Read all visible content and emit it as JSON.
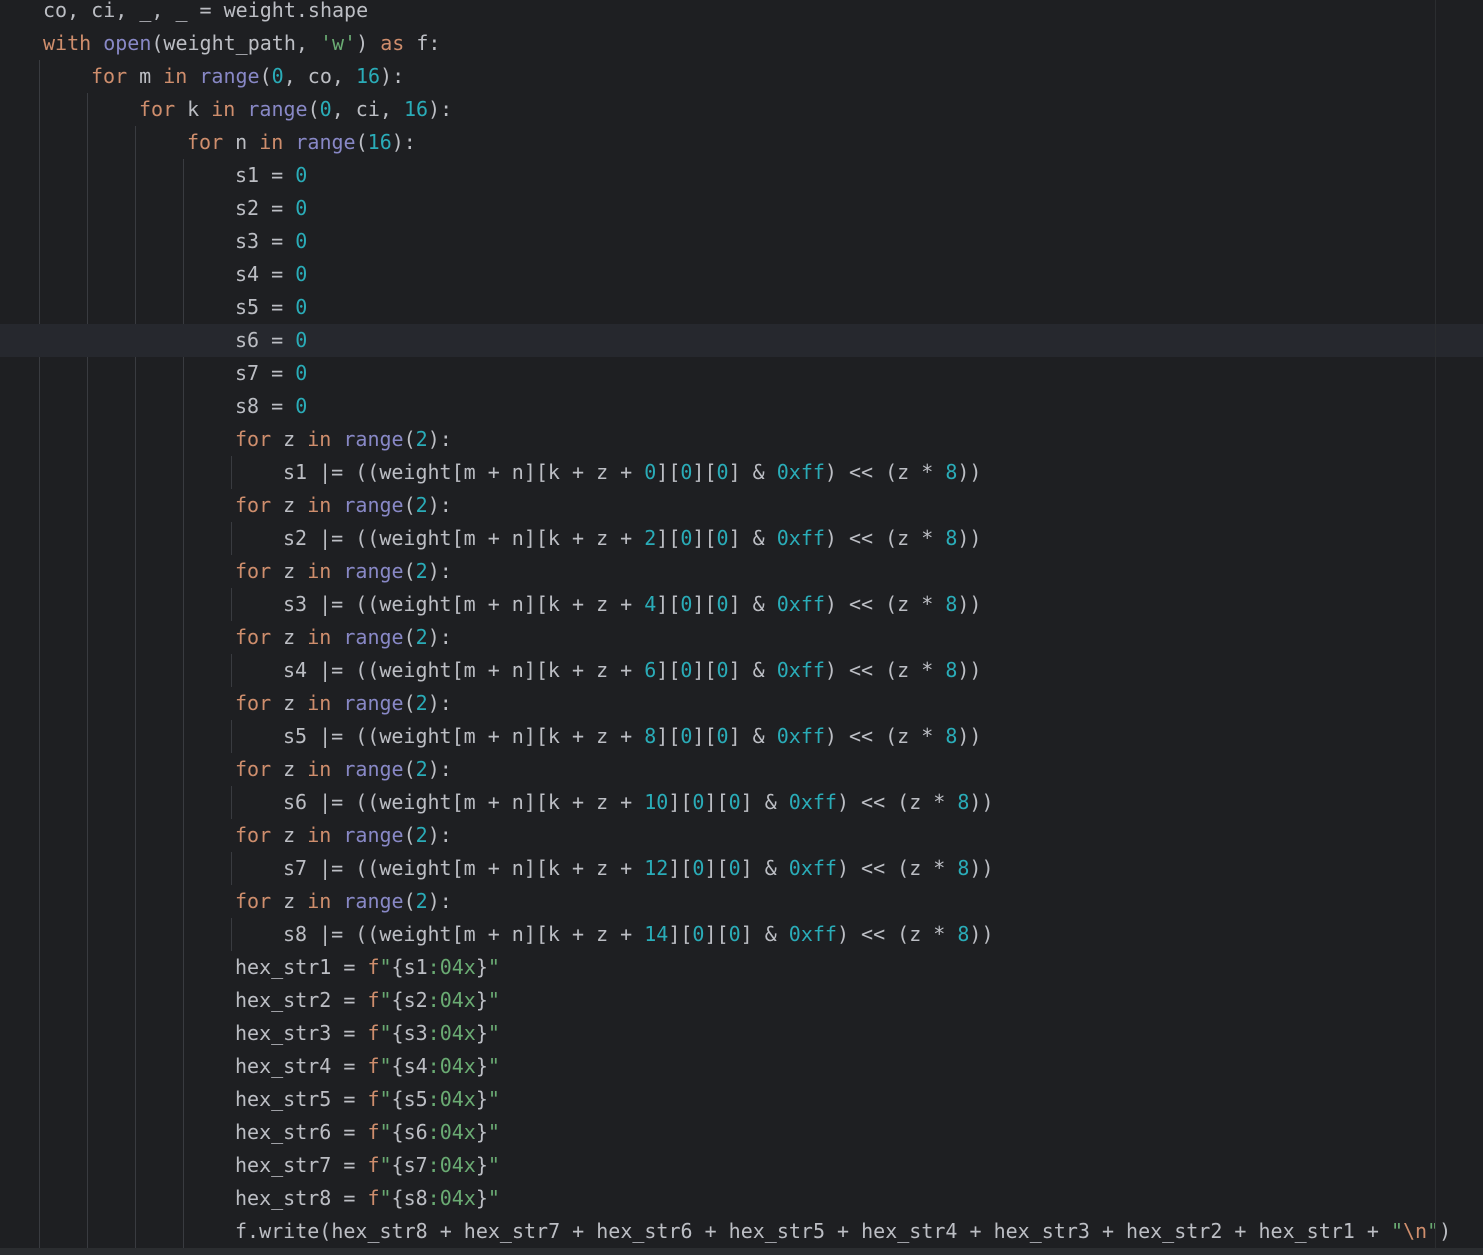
{
  "editor": {
    "language": "python",
    "current_line_index": 10,
    "colors": {
      "background": "#1e1f22",
      "text": "#bcbec4",
      "keyword": "#cf8e6d",
      "builtin": "#8888c6",
      "number": "#2aacb8",
      "string": "#6aab73",
      "current_line": "#26282e"
    },
    "lines": [
      {
        "indent": 0,
        "tokens": [
          [
            "t",
            "co, ci, _, _ = weight.shape"
          ]
        ]
      },
      {
        "indent": 0,
        "tokens": [
          [
            "kw",
            "with"
          ],
          [
            "t",
            " "
          ],
          [
            "bi",
            "open"
          ],
          [
            "t",
            "(weight_path, "
          ],
          [
            "str",
            "'w'"
          ],
          [
            "t",
            ") "
          ],
          [
            "kw",
            "as"
          ],
          [
            "t",
            " f:"
          ]
        ]
      },
      {
        "indent": 1,
        "tokens": [
          [
            "kw",
            "for"
          ],
          [
            "t",
            " m "
          ],
          [
            "kw",
            "in"
          ],
          [
            "t",
            " "
          ],
          [
            "bi",
            "range"
          ],
          [
            "t",
            "("
          ],
          [
            "num",
            "0"
          ],
          [
            "t",
            ", co, "
          ],
          [
            "num",
            "16"
          ],
          [
            "t",
            "):"
          ]
        ]
      },
      {
        "indent": 2,
        "tokens": [
          [
            "kw",
            "for"
          ],
          [
            "t",
            " k "
          ],
          [
            "kw",
            "in"
          ],
          [
            "t",
            " "
          ],
          [
            "bi",
            "range"
          ],
          [
            "t",
            "("
          ],
          [
            "num",
            "0"
          ],
          [
            "t",
            ", ci, "
          ],
          [
            "num",
            "16"
          ],
          [
            "t",
            "):"
          ]
        ]
      },
      {
        "indent": 3,
        "tokens": [
          [
            "kw",
            "for"
          ],
          [
            "t",
            " n "
          ],
          [
            "kw",
            "in"
          ],
          [
            "t",
            " "
          ],
          [
            "bi",
            "range"
          ],
          [
            "t",
            "("
          ],
          [
            "num",
            "16"
          ],
          [
            "t",
            "):"
          ]
        ]
      },
      {
        "indent": 4,
        "tokens": [
          [
            "t",
            "s1 = "
          ],
          [
            "num",
            "0"
          ]
        ]
      },
      {
        "indent": 4,
        "tokens": [
          [
            "t",
            "s2 = "
          ],
          [
            "num",
            "0"
          ]
        ]
      },
      {
        "indent": 4,
        "tokens": [
          [
            "t",
            "s3 = "
          ],
          [
            "num",
            "0"
          ]
        ]
      },
      {
        "indent": 4,
        "tokens": [
          [
            "t",
            "s4 = "
          ],
          [
            "num",
            "0"
          ]
        ]
      },
      {
        "indent": 4,
        "tokens": [
          [
            "t",
            "s5 = "
          ],
          [
            "num",
            "0"
          ]
        ]
      },
      {
        "indent": 4,
        "tokens": [
          [
            "t",
            "s6 = "
          ],
          [
            "num",
            "0"
          ]
        ]
      },
      {
        "indent": 4,
        "tokens": [
          [
            "t",
            "s7 = "
          ],
          [
            "num",
            "0"
          ]
        ]
      },
      {
        "indent": 4,
        "tokens": [
          [
            "t",
            "s8 = "
          ],
          [
            "num",
            "0"
          ]
        ]
      },
      {
        "indent": 4,
        "tokens": [
          [
            "kw",
            "for"
          ],
          [
            "t",
            " z "
          ],
          [
            "kw",
            "in"
          ],
          [
            "t",
            " "
          ],
          [
            "bi",
            "range"
          ],
          [
            "t",
            "("
          ],
          [
            "num",
            "2"
          ],
          [
            "t",
            "):"
          ]
        ]
      },
      {
        "indent": 5,
        "tokens": [
          [
            "t",
            "s1 |= ((weight[m + n][k + z + "
          ],
          [
            "num",
            "0"
          ],
          [
            "t",
            "]["
          ],
          [
            "num",
            "0"
          ],
          [
            "t",
            "]["
          ],
          [
            "num",
            "0"
          ],
          [
            "t",
            "] & "
          ],
          [
            "num",
            "0xff"
          ],
          [
            "t",
            ") << (z * "
          ],
          [
            "num",
            "8"
          ],
          [
            "t",
            "))"
          ]
        ]
      },
      {
        "indent": 4,
        "tokens": [
          [
            "kw",
            "for"
          ],
          [
            "t",
            " z "
          ],
          [
            "kw",
            "in"
          ],
          [
            "t",
            " "
          ],
          [
            "bi",
            "range"
          ],
          [
            "t",
            "("
          ],
          [
            "num",
            "2"
          ],
          [
            "t",
            "):"
          ]
        ]
      },
      {
        "indent": 5,
        "tokens": [
          [
            "t",
            "s2 |= ((weight[m + n][k + z + "
          ],
          [
            "num",
            "2"
          ],
          [
            "t",
            "]["
          ],
          [
            "num",
            "0"
          ],
          [
            "t",
            "]["
          ],
          [
            "num",
            "0"
          ],
          [
            "t",
            "] & "
          ],
          [
            "num",
            "0xff"
          ],
          [
            "t",
            ") << (z * "
          ],
          [
            "num",
            "8"
          ],
          [
            "t",
            "))"
          ]
        ]
      },
      {
        "indent": 4,
        "tokens": [
          [
            "kw",
            "for"
          ],
          [
            "t",
            " z "
          ],
          [
            "kw",
            "in"
          ],
          [
            "t",
            " "
          ],
          [
            "bi",
            "range"
          ],
          [
            "t",
            "("
          ],
          [
            "num",
            "2"
          ],
          [
            "t",
            "):"
          ]
        ]
      },
      {
        "indent": 5,
        "tokens": [
          [
            "t",
            "s3 |= ((weight[m + n][k + z + "
          ],
          [
            "num",
            "4"
          ],
          [
            "t",
            "]["
          ],
          [
            "num",
            "0"
          ],
          [
            "t",
            "]["
          ],
          [
            "num",
            "0"
          ],
          [
            "t",
            "] & "
          ],
          [
            "num",
            "0xff"
          ],
          [
            "t",
            ") << (z * "
          ],
          [
            "num",
            "8"
          ],
          [
            "t",
            "))"
          ]
        ]
      },
      {
        "indent": 4,
        "tokens": [
          [
            "kw",
            "for"
          ],
          [
            "t",
            " z "
          ],
          [
            "kw",
            "in"
          ],
          [
            "t",
            " "
          ],
          [
            "bi",
            "range"
          ],
          [
            "t",
            "("
          ],
          [
            "num",
            "2"
          ],
          [
            "t",
            "):"
          ]
        ]
      },
      {
        "indent": 5,
        "tokens": [
          [
            "t",
            "s4 |= ((weight[m + n][k + z + "
          ],
          [
            "num",
            "6"
          ],
          [
            "t",
            "]["
          ],
          [
            "num",
            "0"
          ],
          [
            "t",
            "]["
          ],
          [
            "num",
            "0"
          ],
          [
            "t",
            "] & "
          ],
          [
            "num",
            "0xff"
          ],
          [
            "t",
            ") << (z * "
          ],
          [
            "num",
            "8"
          ],
          [
            "t",
            "))"
          ]
        ]
      },
      {
        "indent": 4,
        "tokens": [
          [
            "kw",
            "for"
          ],
          [
            "t",
            " z "
          ],
          [
            "kw",
            "in"
          ],
          [
            "t",
            " "
          ],
          [
            "bi",
            "range"
          ],
          [
            "t",
            "("
          ],
          [
            "num",
            "2"
          ],
          [
            "t",
            "):"
          ]
        ]
      },
      {
        "indent": 5,
        "tokens": [
          [
            "t",
            "s5 |= ((weight[m + n][k + z + "
          ],
          [
            "num",
            "8"
          ],
          [
            "t",
            "]["
          ],
          [
            "num",
            "0"
          ],
          [
            "t",
            "]["
          ],
          [
            "num",
            "0"
          ],
          [
            "t",
            "] & "
          ],
          [
            "num",
            "0xff"
          ],
          [
            "t",
            ") << (z * "
          ],
          [
            "num",
            "8"
          ],
          [
            "t",
            "))"
          ]
        ]
      },
      {
        "indent": 4,
        "tokens": [
          [
            "kw",
            "for"
          ],
          [
            "t",
            " z "
          ],
          [
            "kw",
            "in"
          ],
          [
            "t",
            " "
          ],
          [
            "bi",
            "range"
          ],
          [
            "t",
            "("
          ],
          [
            "num",
            "2"
          ],
          [
            "t",
            "):"
          ]
        ]
      },
      {
        "indent": 5,
        "tokens": [
          [
            "t",
            "s6 |= ((weight[m + n][k + z + "
          ],
          [
            "num",
            "10"
          ],
          [
            "t",
            "]["
          ],
          [
            "num",
            "0"
          ],
          [
            "t",
            "]["
          ],
          [
            "num",
            "0"
          ],
          [
            "t",
            "] & "
          ],
          [
            "num",
            "0xff"
          ],
          [
            "t",
            ") << (z * "
          ],
          [
            "num",
            "8"
          ],
          [
            "t",
            "))"
          ]
        ]
      },
      {
        "indent": 4,
        "tokens": [
          [
            "kw",
            "for"
          ],
          [
            "t",
            " z "
          ],
          [
            "kw",
            "in"
          ],
          [
            "t",
            " "
          ],
          [
            "bi",
            "range"
          ],
          [
            "t",
            "("
          ],
          [
            "num",
            "2"
          ],
          [
            "t",
            "):"
          ]
        ]
      },
      {
        "indent": 5,
        "tokens": [
          [
            "t",
            "s7 |= ((weight[m + n][k + z + "
          ],
          [
            "num",
            "12"
          ],
          [
            "t",
            "]["
          ],
          [
            "num",
            "0"
          ],
          [
            "t",
            "]["
          ],
          [
            "num",
            "0"
          ],
          [
            "t",
            "] & "
          ],
          [
            "num",
            "0xff"
          ],
          [
            "t",
            ") << (z * "
          ],
          [
            "num",
            "8"
          ],
          [
            "t",
            "))"
          ]
        ]
      },
      {
        "indent": 4,
        "tokens": [
          [
            "kw",
            "for"
          ],
          [
            "t",
            " z "
          ],
          [
            "kw",
            "in"
          ],
          [
            "t",
            " "
          ],
          [
            "bi",
            "range"
          ],
          [
            "t",
            "("
          ],
          [
            "num",
            "2"
          ],
          [
            "t",
            "):"
          ]
        ]
      },
      {
        "indent": 5,
        "tokens": [
          [
            "t",
            "s8 |= ((weight[m + n][k + z + "
          ],
          [
            "num",
            "14"
          ],
          [
            "t",
            "]["
          ],
          [
            "num",
            "0"
          ],
          [
            "t",
            "]["
          ],
          [
            "num",
            "0"
          ],
          [
            "t",
            "] & "
          ],
          [
            "num",
            "0xff"
          ],
          [
            "t",
            ") << (z * "
          ],
          [
            "num",
            "8"
          ],
          [
            "t",
            "))"
          ]
        ]
      },
      {
        "indent": 4,
        "tokens": [
          [
            "t",
            "hex_str1 = "
          ],
          [
            "fpre",
            "f"
          ],
          [
            "str",
            "\""
          ],
          [
            "t",
            "{s1"
          ],
          [
            "str",
            ":04x"
          ],
          [
            "t",
            "}"
          ],
          [
            "str",
            "\""
          ]
        ]
      },
      {
        "indent": 4,
        "tokens": [
          [
            "t",
            "hex_str2 = "
          ],
          [
            "fpre",
            "f"
          ],
          [
            "str",
            "\""
          ],
          [
            "t",
            "{s2"
          ],
          [
            "str",
            ":04x"
          ],
          [
            "t",
            "}"
          ],
          [
            "str",
            "\""
          ]
        ]
      },
      {
        "indent": 4,
        "tokens": [
          [
            "t",
            "hex_str3 = "
          ],
          [
            "fpre",
            "f"
          ],
          [
            "str",
            "\""
          ],
          [
            "t",
            "{s3"
          ],
          [
            "str",
            ":04x"
          ],
          [
            "t",
            "}"
          ],
          [
            "str",
            "\""
          ]
        ]
      },
      {
        "indent": 4,
        "tokens": [
          [
            "t",
            "hex_str4 = "
          ],
          [
            "fpre",
            "f"
          ],
          [
            "str",
            "\""
          ],
          [
            "t",
            "{s4"
          ],
          [
            "str",
            ":04x"
          ],
          [
            "t",
            "}"
          ],
          [
            "str",
            "\""
          ]
        ]
      },
      {
        "indent": 4,
        "tokens": [
          [
            "t",
            "hex_str5 = "
          ],
          [
            "fpre",
            "f"
          ],
          [
            "str",
            "\""
          ],
          [
            "t",
            "{s5"
          ],
          [
            "str",
            ":04x"
          ],
          [
            "t",
            "}"
          ],
          [
            "str",
            "\""
          ]
        ]
      },
      {
        "indent": 4,
        "tokens": [
          [
            "t",
            "hex_str6 = "
          ],
          [
            "fpre",
            "f"
          ],
          [
            "str",
            "\""
          ],
          [
            "t",
            "{s6"
          ],
          [
            "str",
            ":04x"
          ],
          [
            "t",
            "}"
          ],
          [
            "str",
            "\""
          ]
        ]
      },
      {
        "indent": 4,
        "tokens": [
          [
            "t",
            "hex_str7 = "
          ],
          [
            "fpre",
            "f"
          ],
          [
            "str",
            "\""
          ],
          [
            "t",
            "{s7"
          ],
          [
            "str",
            ":04x"
          ],
          [
            "t",
            "}"
          ],
          [
            "str",
            "\""
          ]
        ]
      },
      {
        "indent": 4,
        "tokens": [
          [
            "t",
            "hex_str8 = "
          ],
          [
            "fpre",
            "f"
          ],
          [
            "str",
            "\""
          ],
          [
            "t",
            "{s8"
          ],
          [
            "str",
            ":04x"
          ],
          [
            "t",
            "}"
          ],
          [
            "str",
            "\""
          ]
        ]
      },
      {
        "indent": 4,
        "tokens": [
          [
            "t",
            "f.write(hex_str8 + hex_str7 + hex_str6 + hex_str5 + hex_str4 + hex_str3 + hex_str2 + hex_str1 + "
          ],
          [
            "str",
            "\""
          ],
          [
            "esc",
            "\\n"
          ],
          [
            "str",
            "\""
          ],
          [
            "t",
            ")"
          ]
        ]
      }
    ]
  }
}
